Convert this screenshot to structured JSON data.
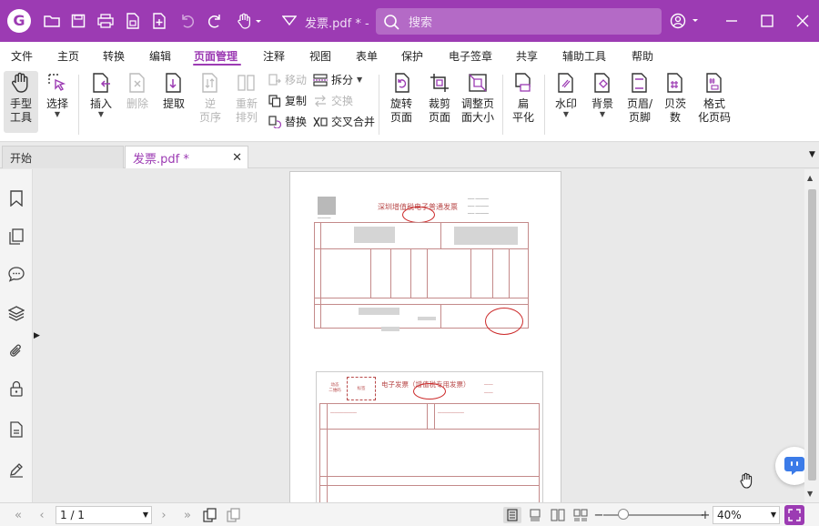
{
  "app": {
    "logo": "G",
    "title": "发票.pdf * - ...",
    "search_placeholder": "搜索",
    "accent": "#9c3bb3"
  },
  "menu": [
    "文件",
    "主页",
    "转换",
    "编辑",
    "页面管理",
    "注释",
    "视图",
    "表单",
    "保护",
    "电子签章",
    "共享",
    "辅助工具",
    "帮助"
  ],
  "ribbon": {
    "hand_tool": [
      "手型",
      "工具"
    ],
    "select": "选择",
    "insert": "插入",
    "delete": "删除",
    "extract": "提取",
    "reverse": [
      "逆",
      "页序"
    ],
    "rearrange": [
      "重新",
      "排列"
    ],
    "move": "移动",
    "copy": "复制",
    "replace": "替换",
    "split": "拆分",
    "swap": "交换",
    "cross_merge": "交叉合并",
    "rotate": [
      "旋转",
      "页面"
    ],
    "crop": [
      "裁剪",
      "页面"
    ],
    "resize": [
      "调整页",
      "面大小"
    ],
    "flatten": [
      "扁",
      "平化"
    ],
    "watermark": "水印",
    "background": "背景",
    "header_footer": [
      "页眉/",
      "页脚"
    ],
    "bates": [
      "贝茨",
      "数"
    ],
    "format_page_num": [
      "格式",
      "化页码"
    ]
  },
  "tabs": {
    "home": "开始",
    "doc": "发票.pdf *"
  },
  "invoice1": {
    "title": "深圳增值税电子普通发票"
  },
  "invoice2": {
    "title": "电子发票（增值税专用发票）",
    "qr_label": [
      "动态",
      "二维码"
    ],
    "mark": "标签"
  },
  "status": {
    "page": "1 / 1",
    "zoom": "40%"
  }
}
